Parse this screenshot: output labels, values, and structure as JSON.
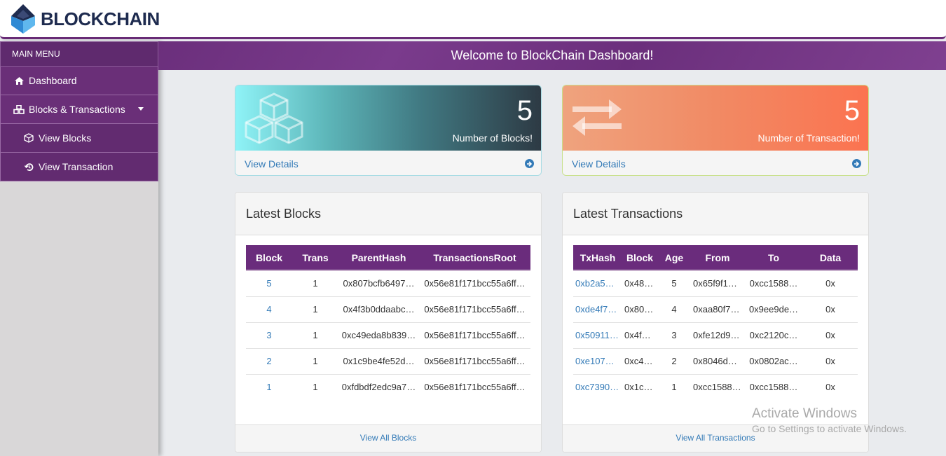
{
  "header": {
    "brand": "BLOCKCHAIN"
  },
  "sidebar": {
    "menu_title": "MAIN MENU",
    "items": [
      {
        "label": "Dashboard",
        "icon": "home-icon"
      },
      {
        "label": "Blocks & Transactions",
        "icon": "cubes-icon"
      },
      {
        "label": "View Blocks",
        "icon": "cube-outline-icon"
      },
      {
        "label": "View Transaction",
        "icon": "history-icon"
      }
    ]
  },
  "banner": {
    "text": "Welcome to BlockChain Dashboard!"
  },
  "cards": {
    "blocks": {
      "count": "5",
      "label": "Number of Blocks!",
      "link": "View Details"
    },
    "transactions": {
      "count": "5",
      "label": "Number of Transaction!",
      "link": "View Details"
    }
  },
  "latest_blocks": {
    "title": "Latest Blocks",
    "columns": [
      "Block",
      "Trans",
      "ParentHash",
      "TransactionsRoot"
    ],
    "rows": [
      [
        "5",
        "1",
        "0x807bcfb6497…",
        "0x56e81f171bcc55a6ff…"
      ],
      [
        "4",
        "1",
        "0x4f3b0ddaabc…",
        "0x56e81f171bcc55a6ff…"
      ],
      [
        "3",
        "1",
        "0xc49eda8b839…",
        "0x56e81f171bcc55a6ff…"
      ],
      [
        "2",
        "1",
        "0x1c9be4fe52d…",
        "0x56e81f171bcc55a6ff…"
      ],
      [
        "1",
        "1",
        "0xfdbdf2edc9a7…",
        "0x56e81f171bcc55a6ff…"
      ]
    ],
    "footer": "View All Blocks"
  },
  "latest_transactions": {
    "title": "Latest Transactions",
    "columns": [
      "TxHash",
      "Block",
      "Age",
      "From",
      "To",
      "Data"
    ],
    "rows": [
      [
        "0xb2a5…",
        "0x486…",
        "5",
        "0x65f9f10…",
        "0xcc1588…",
        "0x"
      ],
      [
        "0xde4f7…",
        "0x807…",
        "4",
        "0xaa80f74…",
        "0x9ee9de…",
        "0x"
      ],
      [
        "0x50911…",
        "0x4f3…",
        "3",
        "0xfe12d9e…",
        "0xc2120c…",
        "0x"
      ],
      [
        "0xe107…",
        "0xc49…",
        "2",
        "0x8046d5…",
        "0x0802ac…",
        "0x"
      ],
      [
        "0xc7390…",
        "0x1c9…",
        "1",
        "0xcc15887…",
        "0xcc1588…",
        "0x"
      ]
    ],
    "footer": "View All Transactions"
  },
  "watermark": {
    "line1": "Activate Windows",
    "line2": "Go to Settings to activate Windows."
  },
  "colors": {
    "accent": "#6a2c7c",
    "link": "#337ab7"
  }
}
